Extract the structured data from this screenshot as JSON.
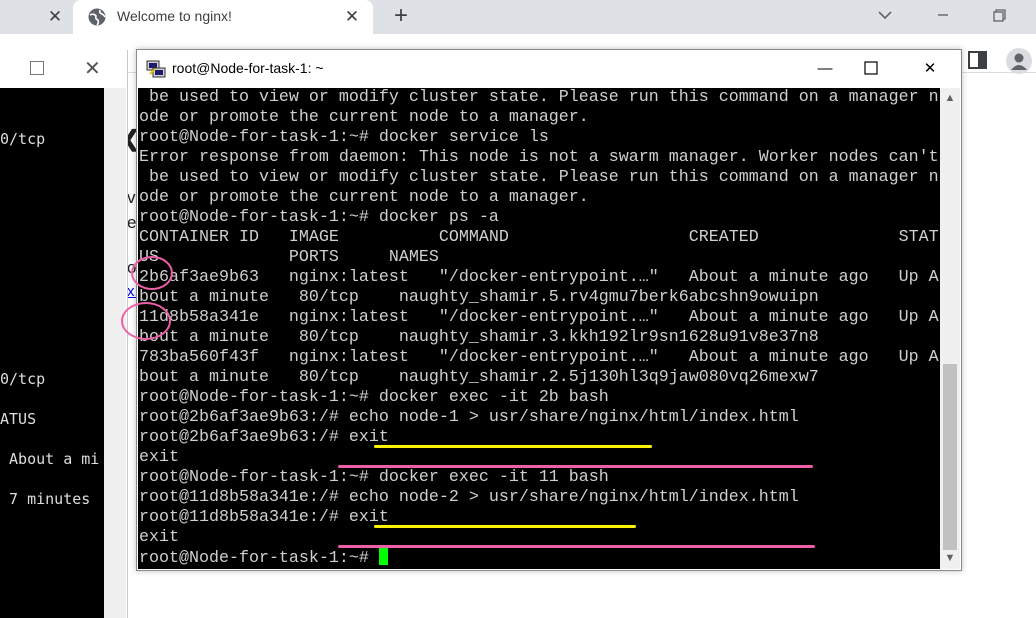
{
  "browser": {
    "tab_title": "Welcome to nginx!",
    "new_tab_symbol": "+",
    "close_symbol": "✕",
    "icons": [
      "globe-icon",
      "close-icon",
      "plus-icon",
      "chevron-down-icon",
      "minimize-icon",
      "restore-icon",
      "side-panel-icon",
      "profile-icon"
    ]
  },
  "left_window": {
    "close_symbol": "✕",
    "lines": [
      "0/tcp",
      "0/tcp",
      "ATUS",
      " About a mi",
      " 7 minutes"
    ]
  },
  "page_fragments": [
    "ve",
    "ed",
    "ol",
    "x."
  ],
  "putty": {
    "title": "root@Node-for-task-1: ~",
    "min_symbol": "—",
    "close_symbol": "✕",
    "lines": [
      " be used to view or modify cluster state. Please run this command on a manager n",
      "ode or promote the current node to a manager.",
      "root@Node-for-task-1:~# docker service ls",
      "Error response from daemon: This node is not a swarm manager. Worker nodes can't",
      " be used to view or modify cluster state. Please run this command on a manager n",
      "ode or promote the current node to a manager.",
      "root@Node-for-task-1:~# docker ps -a",
      "CONTAINER ID   IMAGE          COMMAND                  CREATED              STAT",
      "US             PORTS     NAMES",
      "2b6af3ae9b63   nginx:latest   \"/docker-entrypoint.…\"   About a minute ago   Up A",
      "bout a minute   80/tcp    naughty_shamir.5.rv4gmu7berk6abcshn9owuipn",
      "11d8b58a341e   nginx:latest   \"/docker-entrypoint.…\"   About a minute ago   Up A",
      "bout a minute   80/tcp    naughty_shamir.3.kkh192lr9sn1628u91v8e37n8",
      "783ba560f43f   nginx:latest   \"/docker-entrypoint.…\"   About a minute ago   Up A",
      "bout a minute   80/tcp    naughty_shamir.2.5j130hl3q9jaw080vq26mexw7",
      "root@Node-for-task-1:~# docker exec -it 2b bash",
      "root@2b6af3ae9b63:/# echo node-1 > usr/share/nginx/html/index.html",
      "root@2b6af3ae9b63:/# exit",
      "exit",
      "root@Node-for-task-1:~# docker exec -it 11 bash",
      "root@11d8b58a341e:/# echo node-2 > usr/share/nginx/html/index.html",
      "root@11d8b58a341e:/# exit",
      "exit",
      "root@Node-for-task-1:~# "
    ]
  },
  "annotation_colors": {
    "yellow": "#fff200",
    "pink": "#ee5fa7"
  },
  "cursor_color": "#00ff00"
}
